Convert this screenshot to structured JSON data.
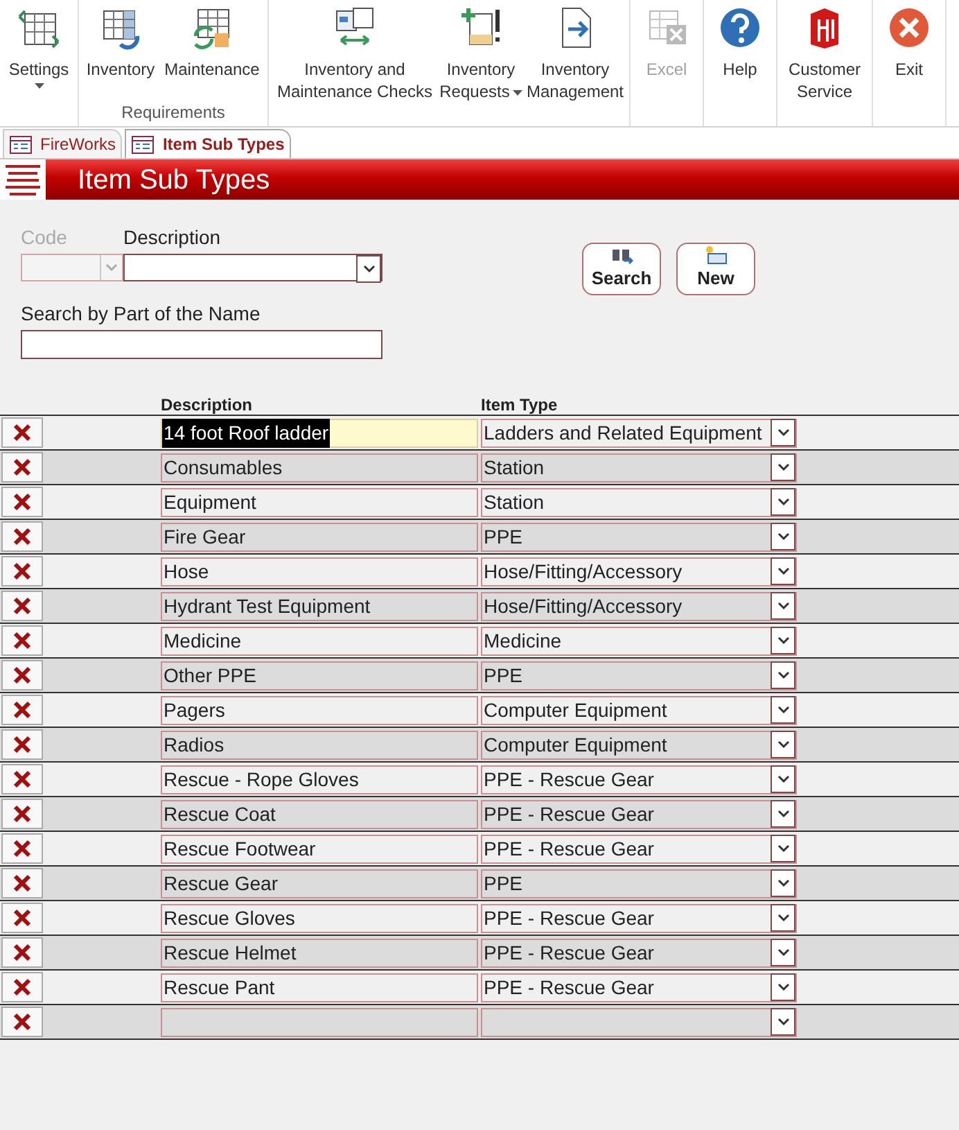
{
  "ribbon": {
    "groups": [
      {
        "buttons": [
          {
            "label": "Settings",
            "dropdown": true,
            "disabled": false
          }
        ]
      },
      {
        "label": "Requirements",
        "buttons": [
          {
            "label": "Inventory",
            "dropdown": false,
            "disabled": false
          },
          {
            "label": "Maintenance",
            "dropdown": false,
            "disabled": false
          }
        ]
      },
      {
        "buttons": [
          {
            "label": "Inventory and Maintenance Checks",
            "dropdown": false,
            "disabled": false
          },
          {
            "label": "Inventory Requests",
            "dropdown": true,
            "disabled": false
          },
          {
            "label": "Inventory Management",
            "dropdown": false,
            "disabled": false
          }
        ]
      },
      {
        "buttons": [
          {
            "label": "Excel",
            "dropdown": false,
            "disabled": true
          }
        ]
      },
      {
        "buttons": [
          {
            "label": "Help",
            "dropdown": false,
            "disabled": false
          }
        ]
      },
      {
        "buttons": [
          {
            "label": "Customer Service",
            "dropdown": false,
            "disabled": false
          }
        ]
      },
      {
        "buttons": [
          {
            "label": "Exit",
            "dropdown": false,
            "disabled": false
          }
        ]
      }
    ]
  },
  "tabs": [
    {
      "label": "FireWorks",
      "selected": false
    },
    {
      "label": "Item Sub Types",
      "selected": true
    }
  ],
  "header": {
    "title": "Item Sub Types"
  },
  "filters": {
    "code": {
      "label": "Code",
      "disabled": true
    },
    "description": {
      "label": "Description"
    },
    "search_name": {
      "label": "Search by Part of the Name"
    }
  },
  "buttons": [
    {
      "label": "Search"
    },
    {
      "label": "New"
    }
  ],
  "table": {
    "columns": [
      "Description",
      "Item Type"
    ],
    "new_record_row": true,
    "rows": [
      {
        "description": "14 foot Roof ladder",
        "item_type": "Ladders and Related Equipment",
        "selected": true
      },
      {
        "description": "Consumables",
        "item_type": "Station",
        "selected": false
      },
      {
        "description": "Equipment",
        "item_type": "Station",
        "selected": false
      },
      {
        "description": "Fire Gear",
        "item_type": "PPE",
        "selected": false
      },
      {
        "description": "Hose",
        "item_type": "Hose/Fitting/Accessory",
        "selected": false
      },
      {
        "description": "Hydrant Test Equipment",
        "item_type": "Hose/Fitting/Accessory",
        "selected": false
      },
      {
        "description": "Medicine",
        "item_type": "Medicine",
        "selected": false
      },
      {
        "description": "Other PPE",
        "item_type": "PPE",
        "selected": false
      },
      {
        "description": "Pagers",
        "item_type": "Computer Equipment",
        "selected": false
      },
      {
        "description": "Radios",
        "item_type": "Computer Equipment",
        "selected": false
      },
      {
        "description": "Rescue - Rope Gloves",
        "item_type": "PPE - Rescue Gear",
        "selected": false
      },
      {
        "description": "Rescue Coat",
        "item_type": "PPE - Rescue Gear",
        "selected": false
      },
      {
        "description": "Rescue Footwear",
        "item_type": "PPE - Rescue Gear",
        "selected": false
      },
      {
        "description": "Rescue Gear",
        "item_type": "PPE",
        "selected": false
      },
      {
        "description": "Rescue Gloves",
        "item_type": "PPE - Rescue Gear",
        "selected": false
      },
      {
        "description": "Rescue Helmet",
        "item_type": "PPE - Rescue Gear",
        "selected": false
      },
      {
        "description": "Rescue Pant",
        "item_type": "PPE - Rescue Gear",
        "selected": false
      }
    ]
  }
}
